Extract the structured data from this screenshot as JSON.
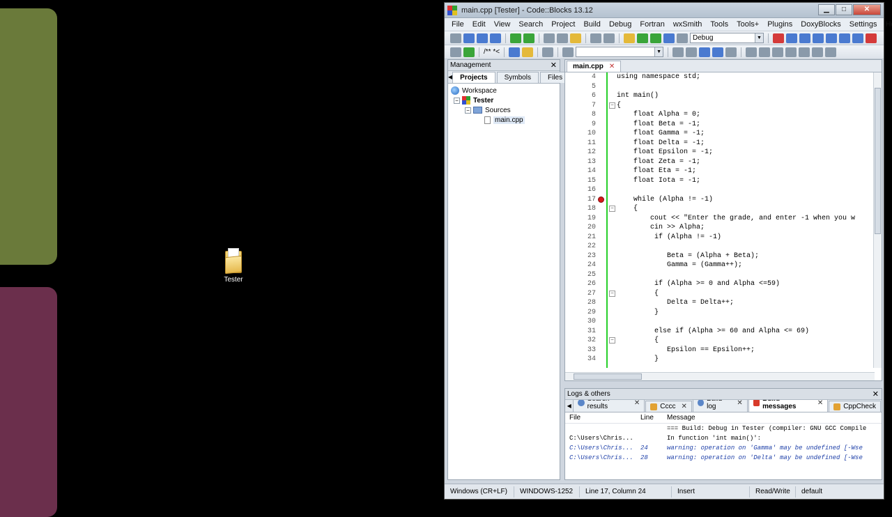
{
  "desktop": {
    "folder_label": "Tester"
  },
  "window": {
    "title": "main.cpp [Tester] - Code::Blocks 13.12",
    "minimize": "▁",
    "maximize": "□",
    "close": "✕"
  },
  "menu": [
    "File",
    "Edit",
    "View",
    "Search",
    "Project",
    "Build",
    "Debug",
    "Fortran",
    "wxSmith",
    "Tools",
    "Tools+",
    "Plugins",
    "DoxyBlocks",
    "Settings",
    "Help"
  ],
  "toolbar": {
    "build_target": "Debug",
    "doxy_label": "/** *<"
  },
  "management": {
    "title": "Management",
    "tabs": [
      "Projects",
      "Symbols",
      "Files"
    ],
    "tree": {
      "workspace": "Workspace",
      "project": "Tester",
      "folder": "Sources",
      "file": "main.cpp"
    }
  },
  "editor": {
    "tab": "main.cpp",
    "lines": [
      {
        "n": "4",
        "t": "using namespace std;"
      },
      {
        "n": "5",
        "t": ""
      },
      {
        "n": "6",
        "t": "int main()"
      },
      {
        "n": "7",
        "t": "{"
      },
      {
        "n": "8",
        "t": "    float Alpha = 0;"
      },
      {
        "n": "9",
        "t": "    float Beta = -1;"
      },
      {
        "n": "10",
        "t": "    float Gamma = -1;"
      },
      {
        "n": "11",
        "t": "    float Delta = -1;"
      },
      {
        "n": "12",
        "t": "    float Epsilon = -1;"
      },
      {
        "n": "13",
        "t": "    float Zeta = -1;"
      },
      {
        "n": "14",
        "t": "    float Eta = -1;"
      },
      {
        "n": "15",
        "t": "    float Iota = -1;"
      },
      {
        "n": "16",
        "t": ""
      },
      {
        "n": "17",
        "t": "    while (Alpha != -1)"
      },
      {
        "n": "18",
        "t": "    {"
      },
      {
        "n": "19",
        "t": "        cout << \"Enter the grade, and enter -1 when you w"
      },
      {
        "n": "20",
        "t": "        cin >> Alpha;"
      },
      {
        "n": "21",
        "t": "         if (Alpha != -1)"
      },
      {
        "n": "22",
        "t": ""
      },
      {
        "n": "23",
        "t": "            Beta = (Alpha + Beta);"
      },
      {
        "n": "24",
        "t": "            Gamma = (Gamma++);"
      },
      {
        "n": "25",
        "t": ""
      },
      {
        "n": "26",
        "t": "         if (Alpha >= 0 and Alpha <=59)"
      },
      {
        "n": "27",
        "t": "         {"
      },
      {
        "n": "28",
        "t": "            Delta = Delta++;"
      },
      {
        "n": "29",
        "t": "         }"
      },
      {
        "n": "30",
        "t": ""
      },
      {
        "n": "31",
        "t": "         else if (Alpha >= 60 and Alpha <= 69)"
      },
      {
        "n": "32",
        "t": "         {"
      },
      {
        "n": "33",
        "t": "            Epsilon == Epsilon++;"
      },
      {
        "n": "34",
        "t": "         }"
      }
    ]
  },
  "logs": {
    "title": "Logs & others",
    "tabs": [
      "Search results",
      "Cccc",
      "Build log",
      "Build messages",
      "CppCheck"
    ],
    "columns": [
      "File",
      "Line",
      "Message"
    ],
    "rows": [
      {
        "file": "",
        "line": "",
        "msg": "=== Build: Debug in Tester (compiler: GNU GCC Compile",
        "warn": false
      },
      {
        "file": "C:\\Users\\Chris...",
        "line": "",
        "msg": "In function 'int main()':",
        "warn": false
      },
      {
        "file": "C:\\Users\\Chris...",
        "line": "24",
        "msg": "warning: operation on 'Gamma' may be undefined [-Wse",
        "warn": true
      },
      {
        "file": "C:\\Users\\Chris...",
        "line": "28",
        "msg": "warning: operation on 'Delta' may be undefined [-Wse",
        "warn": true
      }
    ]
  },
  "status": {
    "eol": "Windows (CR+LF)",
    "encoding": "WINDOWS-1252",
    "position": "Line 17, Column 24",
    "mode": "Insert",
    "access": "Read/Write",
    "profile": "default"
  }
}
